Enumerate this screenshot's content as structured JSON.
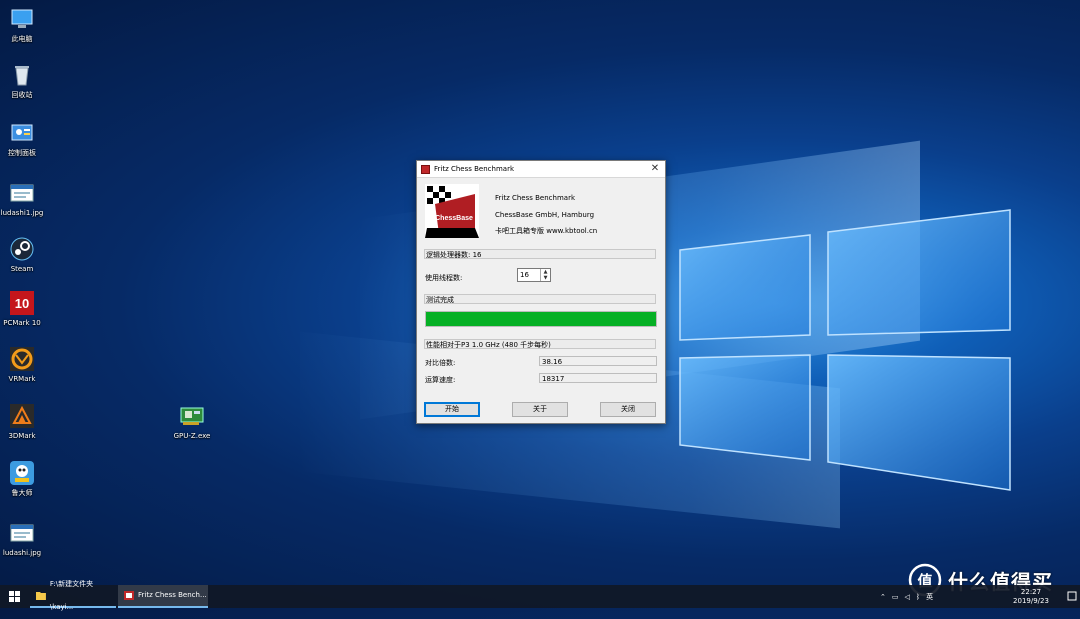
{
  "desktop": {
    "icons": [
      {
        "label": "此电脑",
        "icon": "this-pc-icon"
      },
      {
        "label": "回收站",
        "icon": "recycle-bin-icon"
      },
      {
        "label": "控制面板",
        "icon": "control-panel-icon"
      },
      {
        "label": "ludashi1.jpg",
        "icon": "image-file-icon"
      },
      {
        "label": "Steam",
        "icon": "steam-icon"
      },
      {
        "label": "PCMark 10",
        "icon": "pcmark-icon"
      },
      {
        "label": "VRMark",
        "icon": "vrmark-icon"
      },
      {
        "label": "3DMark",
        "icon": "3dmark-icon"
      },
      {
        "label": "鲁大师",
        "icon": "ludashi-icon"
      },
      {
        "label": "ludashi.jpg",
        "icon": "image-file-icon"
      },
      {
        "label": "GPU-Z.exe",
        "icon": "gpuz-icon"
      }
    ]
  },
  "dialog": {
    "title": "Fritz Chess Benchmark",
    "logo_text": "ChessBase",
    "app_name": "Fritz Chess Benchmark",
    "company": "ChessBase GmbH, Hamburg",
    "publisher": "卡吧工具箱专版 www.kbtool.cn",
    "logical_processors": "逻辑处理器数: 16",
    "threads_label": "使用线程数:",
    "threads_value": "16",
    "status_text": "测试完成",
    "progress": 1.0,
    "progress_color": "#06b025",
    "perf_header": "性能相对于P3 1.0 GHz (480 千步每秒)",
    "ratio_label": "对比倍数:",
    "ratio_value": "38.16",
    "speed_label": "运算速度:",
    "speed_value": "18317",
    "buttons": {
      "start": "开始",
      "about": "关于",
      "close": "关闭"
    }
  },
  "taskbar": {
    "items": [
      {
        "label": "F:\\新建文件夹\\kayi...",
        "icon": "folder-icon"
      },
      {
        "label": "Fritz Chess Bench...",
        "icon": "fritz-icon"
      }
    ],
    "tray_lang": "英",
    "clock_time": "22:27",
    "clock_date": "2019/9/23"
  },
  "watermark": {
    "text": "什么值得买",
    "badge": "值"
  }
}
